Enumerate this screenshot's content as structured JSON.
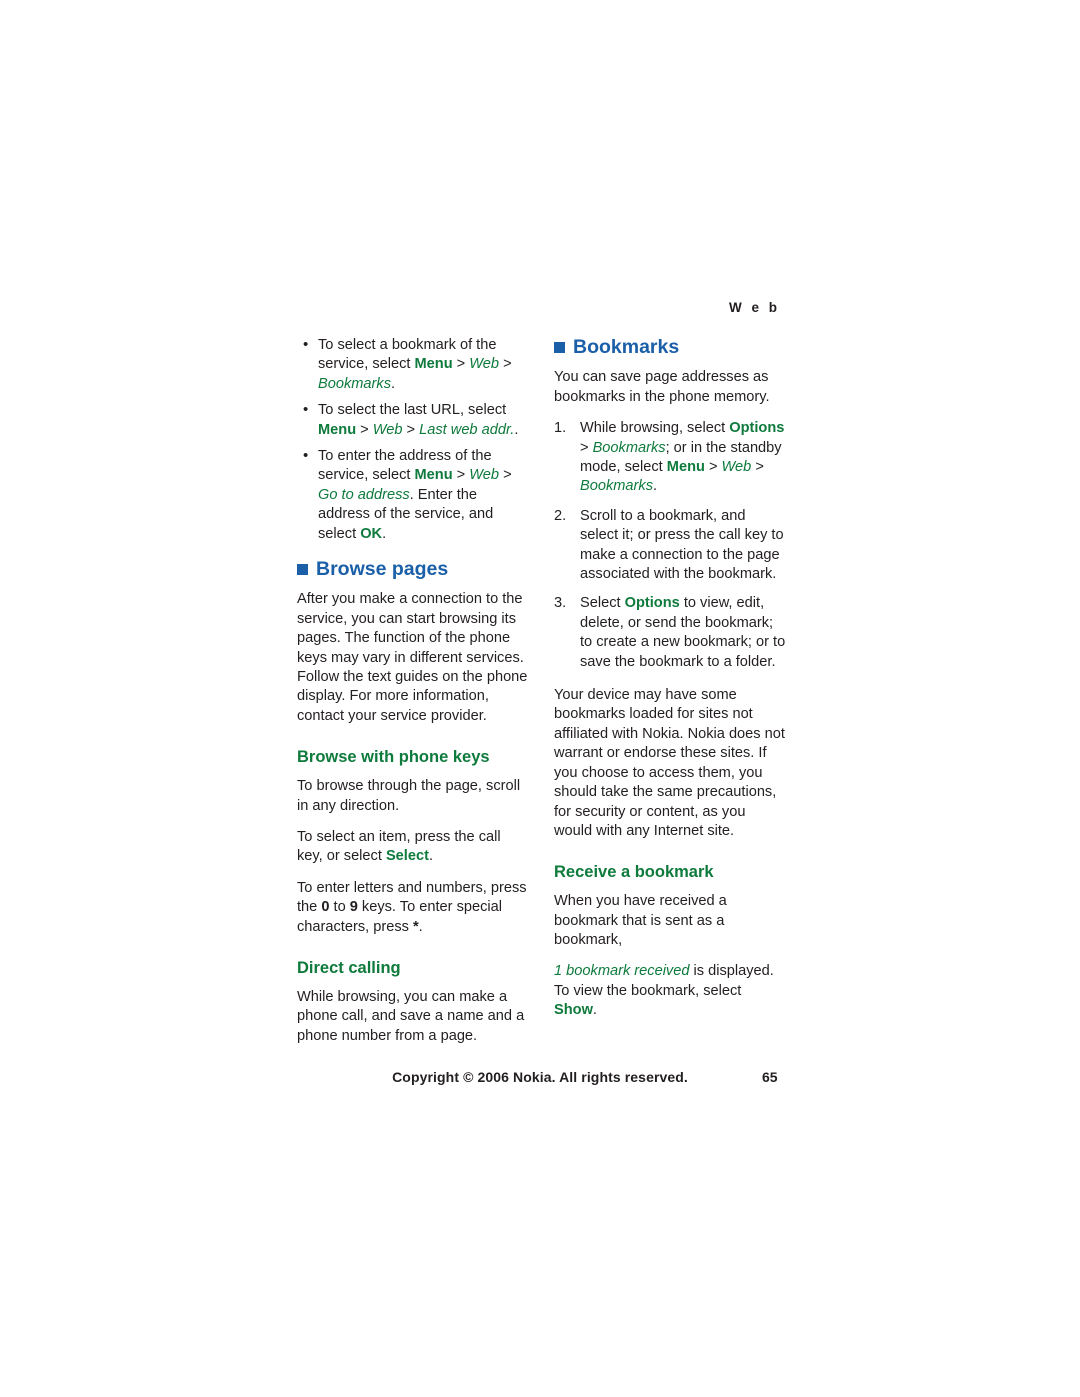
{
  "header": {
    "running_head": "W e b"
  },
  "left_column": {
    "bullets": [
      {
        "parts": [
          {
            "t": "To select a bookmark of the service, select ",
            "s": "plain"
          },
          {
            "t": "Menu",
            "s": "green-bold"
          },
          {
            "t": " > ",
            "s": "plain"
          },
          {
            "t": "Web",
            "s": "green-italic"
          },
          {
            "t": " > ",
            "s": "plain"
          },
          {
            "t": "Bookmarks",
            "s": "green-italic"
          },
          {
            "t": ".",
            "s": "plain"
          }
        ]
      },
      {
        "parts": [
          {
            "t": "To select the last URL, select ",
            "s": "plain"
          },
          {
            "t": "Menu",
            "s": "green-bold"
          },
          {
            "t": " > ",
            "s": "plain"
          },
          {
            "t": "Web",
            "s": "green-italic"
          },
          {
            "t": " > ",
            "s": "plain"
          },
          {
            "t": "Last web addr.",
            "s": "green-italic"
          },
          {
            "t": ".",
            "s": "plain"
          }
        ]
      },
      {
        "parts": [
          {
            "t": "To enter the address of the service, select ",
            "s": "plain"
          },
          {
            "t": "Menu",
            "s": "green-bold"
          },
          {
            "t": " > ",
            "s": "plain"
          },
          {
            "t": "Web",
            "s": "green-italic"
          },
          {
            "t": " > ",
            "s": "plain"
          },
          {
            "t": "Go to address",
            "s": "green-italic"
          },
          {
            "t": ". Enter the address of the service, and select ",
            "s": "plain"
          },
          {
            "t": "OK",
            "s": "green-bold"
          },
          {
            "t": ".",
            "s": "plain"
          }
        ]
      }
    ],
    "browse_pages_heading": "Browse pages",
    "browse_pages_body": "After you make a connection to the service, you can start browsing its pages. The function of the phone keys may vary in different services. Follow the text guides on the phone display. For more information, contact your service provider.",
    "browse_keys_heading": "Browse with phone keys",
    "browse_keys_p1": "To browse through the page, scroll in any direction.",
    "browse_keys_p2": [
      {
        "t": "To select an item, press the call key, or select ",
        "s": "plain"
      },
      {
        "t": "Select",
        "s": "green-bold"
      },
      {
        "t": ".",
        "s": "plain"
      }
    ],
    "browse_keys_p3": [
      {
        "t": "To enter letters and numbers, press the ",
        "s": "plain"
      },
      {
        "t": "0",
        "s": "bold"
      },
      {
        "t": " to ",
        "s": "plain"
      },
      {
        "t": "9",
        "s": "bold"
      },
      {
        "t": " keys. To enter special characters, press ",
        "s": "plain"
      },
      {
        "t": "*",
        "s": "bold"
      },
      {
        "t": ".",
        "s": "plain"
      }
    ],
    "direct_calling_heading": "Direct calling",
    "direct_calling_body": "While browsing, you can make a phone call, and save a name and a phone number from a page."
  },
  "right_column": {
    "bookmarks_heading": "Bookmarks",
    "bookmarks_intro": "You can save page addresses as bookmarks in the phone memory.",
    "steps": [
      {
        "parts": [
          {
            "t": "While browsing, select ",
            "s": "plain"
          },
          {
            "t": "Options",
            "s": "green-bold"
          },
          {
            "t": " > ",
            "s": "plain"
          },
          {
            "t": "Bookmarks",
            "s": "green-italic"
          },
          {
            "t": "; or in the standby mode, select ",
            "s": "plain"
          },
          {
            "t": "Menu",
            "s": "green-bold"
          },
          {
            "t": " > ",
            "s": "plain"
          },
          {
            "t": "Web",
            "s": "green-italic"
          },
          {
            "t": " > ",
            "s": "plain"
          },
          {
            "t": "Bookmarks",
            "s": "green-italic"
          },
          {
            "t": ".",
            "s": "plain"
          }
        ]
      },
      {
        "parts": [
          {
            "t": "Scroll to a bookmark, and select it; or press the call key to make a connection to the page associated with the bookmark.",
            "s": "plain"
          }
        ]
      },
      {
        "parts": [
          {
            "t": "Select ",
            "s": "plain"
          },
          {
            "t": "Options",
            "s": "green-bold"
          },
          {
            "t": " to view, edit, delete, or send the bookmark; to create a new bookmark; or to save the bookmark to a folder.",
            "s": "plain"
          }
        ]
      }
    ],
    "disclaimer": "Your device may have some bookmarks loaded for sites not affiliated with Nokia. Nokia does not warrant or endorse these sites. If you choose to access them, you should take the same precautions, for security or content, as you would with any Internet site.",
    "receive_heading": "Receive a bookmark",
    "receive_p1": "When you have received a bookmark that is sent as a bookmark,",
    "receive_p2": [
      {
        "t": "1 bookmark received",
        "s": "green-italic"
      },
      {
        "t": " is displayed. To view the bookmark, select ",
        "s": "plain"
      },
      {
        "t": "Show",
        "s": "green-bold"
      },
      {
        "t": ".",
        "s": "plain"
      }
    ]
  },
  "footer": {
    "copyright": "Copyright © 2006 Nokia. All rights reserved.",
    "page_number": "65"
  },
  "colors": {
    "heading_blue": "#1a5fa8",
    "subheading_green": "#0e7a3c",
    "body_black": "#231f20"
  }
}
